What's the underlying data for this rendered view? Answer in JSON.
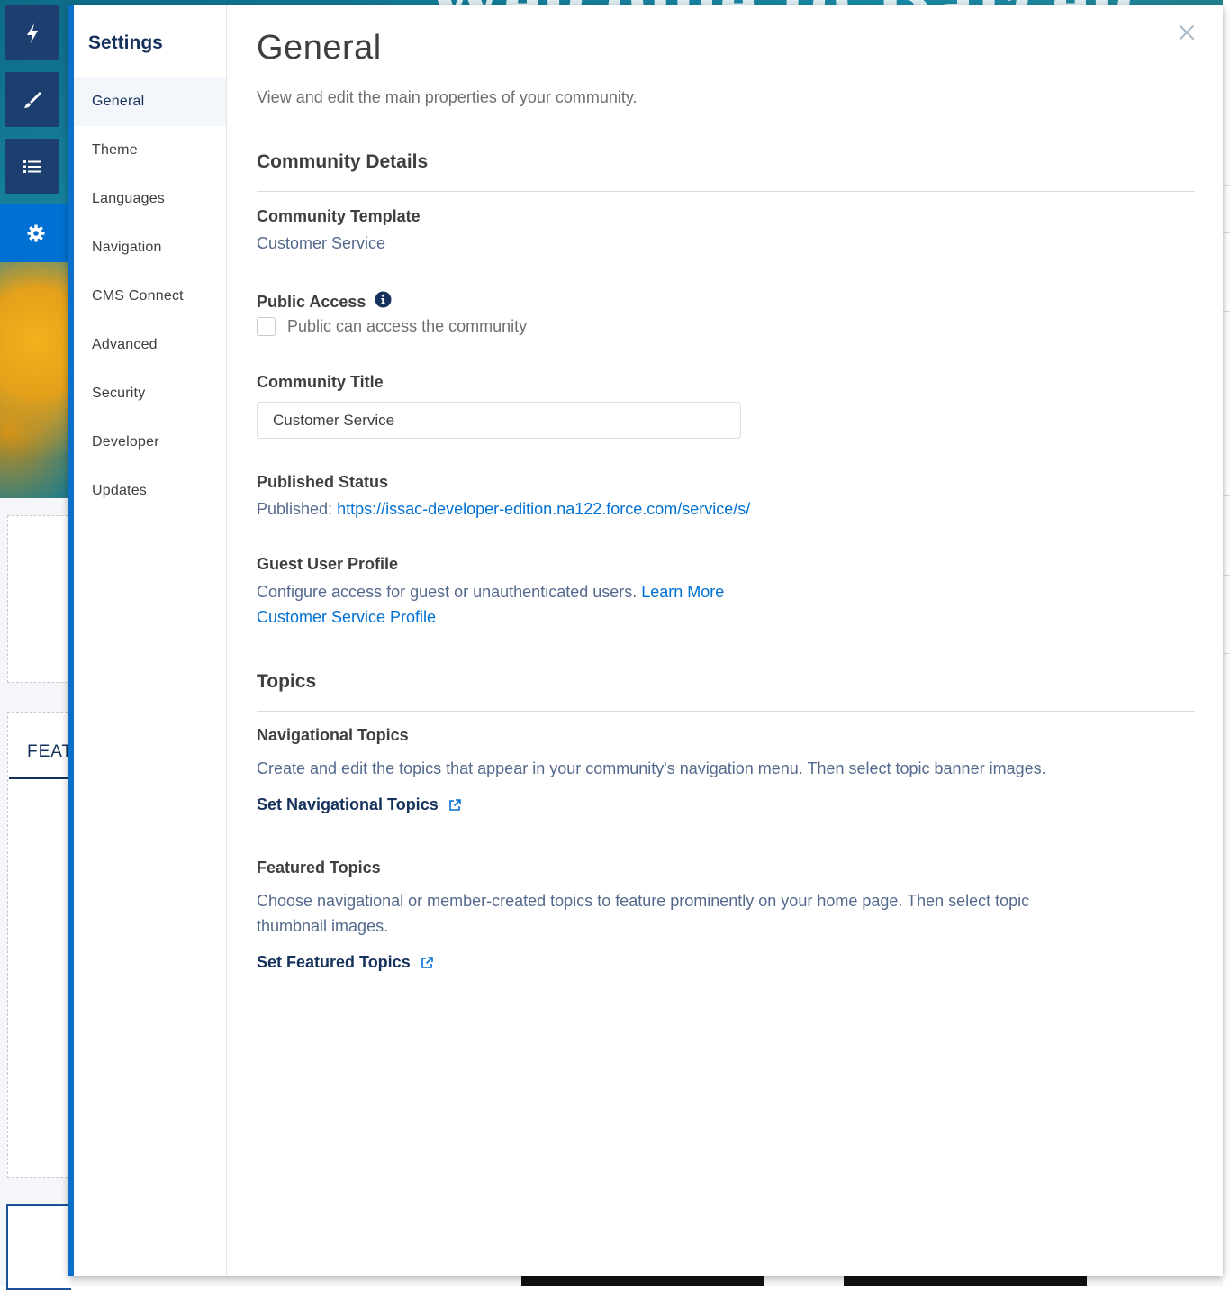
{
  "background": {
    "hero_text": "Welcome to Barcelc",
    "feature_label": "FEAT"
  },
  "toolbar": {
    "items": [
      {
        "icon": "lightning-icon"
      },
      {
        "icon": "brush-icon"
      },
      {
        "icon": "list-icon"
      },
      {
        "icon": "gear-icon",
        "active": true
      }
    ]
  },
  "settings": {
    "title": "Settings",
    "nav": [
      {
        "label": "General",
        "active": true
      },
      {
        "label": "Theme"
      },
      {
        "label": "Languages"
      },
      {
        "label": "Navigation"
      },
      {
        "label": "CMS Connect"
      },
      {
        "label": "Advanced"
      },
      {
        "label": "Security"
      },
      {
        "label": "Developer"
      },
      {
        "label": "Updates"
      }
    ]
  },
  "main": {
    "title": "General",
    "description": "View and edit the main properties of your community.",
    "community_details": {
      "heading": "Community Details",
      "template_label": "Community Template",
      "template_value": "Customer Service",
      "public_access_label": "Public Access",
      "public_access_checkbox_label": "Public can access the community",
      "public_access_checked": false,
      "title_label": "Community Title",
      "title_value": "Customer Service",
      "published_label": "Published Status",
      "published_prefix": "Published: ",
      "published_url": "https://issac-developer-edition.na122.force.com/service/s/",
      "guest_label": "Guest User Profile",
      "guest_text": "Configure access for guest or unauthenticated users. ",
      "learn_more": "Learn More",
      "guest_profile_link": "Customer Service Profile"
    },
    "topics": {
      "heading": "Topics",
      "nav_topics_label": "Navigational Topics",
      "nav_topics_text": "Create and edit the topics that appear in your community's navigation menu. Then select topic banner images.",
      "nav_topics_link": "Set Navigational Topics",
      "featured_label": "Featured Topics",
      "featured_text_line1": "Choose navigational or member-created topics to feature prominently on your home page. Then select topic",
      "featured_text_line2": "thumbnail images.",
      "featured_link": "Set Featured Topics"
    }
  },
  "colors": {
    "accent": "#0070d2",
    "toolbar": "#1c3f70",
    "modal_border": "#0a70c9"
  }
}
